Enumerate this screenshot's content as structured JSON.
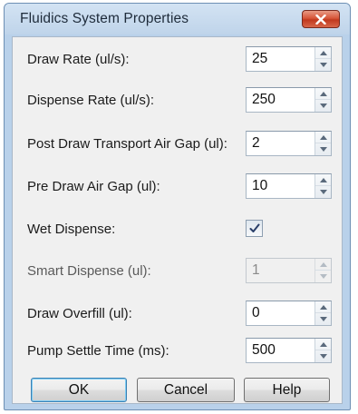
{
  "window": {
    "title": "Fluidics System Properties"
  },
  "fields": [
    {
      "label": "Draw Rate (ul/s):",
      "value": "25",
      "enabled": true
    },
    {
      "label": "Dispense Rate (ul/s):",
      "value": "250",
      "enabled": true
    },
    {
      "label": "Post Draw Transport Air Gap (ul):",
      "value": "2",
      "enabled": true
    },
    {
      "label": "Pre Draw Air Gap (ul):",
      "value": "10",
      "enabled": true
    },
    {
      "label": "Wet Dispense:",
      "checked": true
    },
    {
      "label": "Smart Dispense (ul):",
      "value": "1",
      "enabled": false
    },
    {
      "label": "Draw Overfill (ul):",
      "value": "0",
      "enabled": true
    },
    {
      "label": "Pump Settle Time (ms):",
      "value": "500",
      "enabled": true
    }
  ],
  "buttons": {
    "ok": "OK",
    "cancel": "Cancel",
    "help": "Help"
  },
  "icons": {
    "close": "close-icon",
    "spin_up": "chevron-up-icon",
    "spin_down": "chevron-down-icon",
    "check": "checkmark-icon"
  }
}
